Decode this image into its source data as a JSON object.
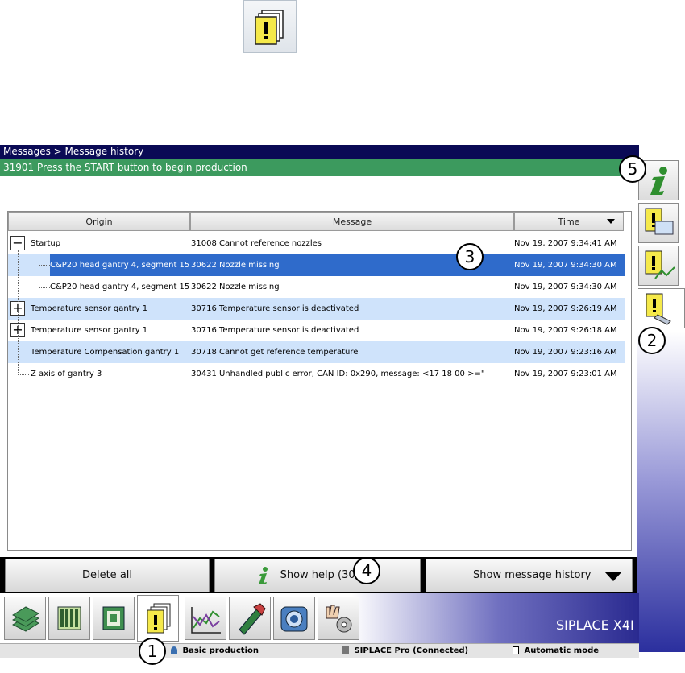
{
  "top_icon": "message-window-icon",
  "header": {
    "breadcrumb": "Messages > Message history",
    "status_message": "31901 Press the START button to begin production"
  },
  "table": {
    "columns": [
      "Origin",
      "Message",
      "Time"
    ],
    "rows": [
      {
        "origin": "Startup",
        "message": "31008 Cannot reference nozzles",
        "time": "Nov 19, 2007 9:34:41 AM"
      },
      {
        "origin": "C&P20 head gantry 4, segment 15",
        "message": "30622 Nozzle missing",
        "time": "Nov 19, 2007 9:34:30 AM"
      },
      {
        "origin": "C&P20 head gantry 4, segment 15",
        "message": "30622 Nozzle missing",
        "time": "Nov 19, 2007 9:34:30 AM"
      },
      {
        "origin": "Temperature sensor gantry 1",
        "message": "30716 Temperature sensor is deactivated",
        "time": "Nov 19, 2007 9:26:19 AM"
      },
      {
        "origin": "Temperature sensor gantry 1",
        "message": "30716 Temperature sensor is deactivated",
        "time": "Nov 19, 2007 9:26:18 AM"
      },
      {
        "origin": "Temperature Compensation gantry 1",
        "message": "30718 Cannot get reference temperature",
        "time": "Nov 19, 2007 9:23:16 AM"
      },
      {
        "origin": "Z axis of gantry 3",
        "message": "30431 Unhandled public error, CAN ID: 0x290, message: <17 18 00 >=\"",
        "time": "Nov 19, 2007 9:23:01 AM"
      }
    ]
  },
  "buttons": {
    "delete_all": "Delete all",
    "show_help": "Show help (30622)",
    "show_history": "Show message history"
  },
  "sidebar_tabs": [
    "info-icon",
    "message-display-icon",
    "message-chart-icon",
    "message-history-icon"
  ],
  "nav_buttons": [
    "boards-icon",
    "setup-grid-icon",
    "component-icon",
    "messages-icon",
    "chart-icon",
    "feeder-icon",
    "camera-icon",
    "settings-icon"
  ],
  "brand": "SIPLACE X4I",
  "status_bar": {
    "user": "Basic production",
    "connection": "SIPLACE Pro (Connected)",
    "mode": "Automatic mode"
  },
  "callouts": [
    "1",
    "2",
    "3",
    "4",
    "5"
  ],
  "colors": {
    "title_bg": "#0a0a55",
    "status_green": "#3c9a5e",
    "selection": "#2f6bcb",
    "highlight": "#cfe3fb"
  }
}
